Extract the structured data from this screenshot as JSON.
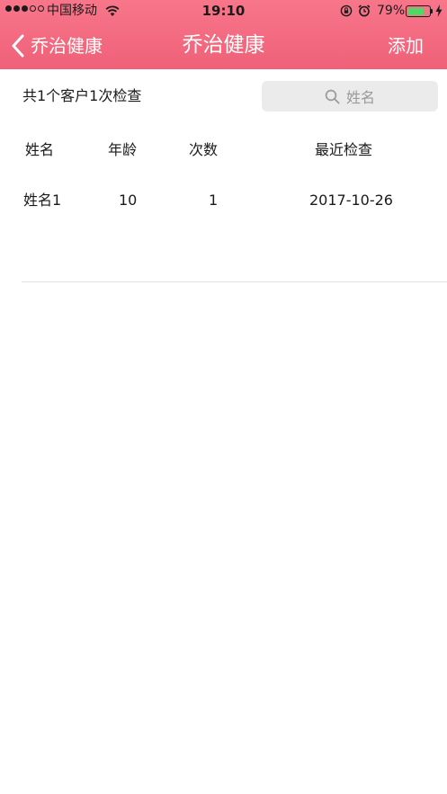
{
  "status_bar": {
    "carrier": "中国移动",
    "time": "19:10",
    "battery_percent": "79%",
    "battery_level": 0.79,
    "battery_color": "#4cd964",
    "signal_bars_filled": 3,
    "signal_bars_total": 5,
    "icons": [
      "wifi-icon",
      "rotation-lock-icon",
      "alarm-icon",
      "battery-icon",
      "charging-bolt-icon"
    ]
  },
  "nav": {
    "back_label": "乔治健康",
    "title": "乔治健康",
    "add_label": "添加",
    "background_top": "#f8768a",
    "background_bottom": "#ef6178"
  },
  "summary": {
    "text": "共1个客户1次检查"
  },
  "search": {
    "placeholder": "姓名",
    "icon": "search-icon"
  },
  "table": {
    "columns": [
      "姓名",
      "年龄",
      "次数",
      "最近检查"
    ],
    "rows": [
      [
        "姓名1",
        "10",
        "1",
        "2017-10-26"
      ]
    ]
  }
}
